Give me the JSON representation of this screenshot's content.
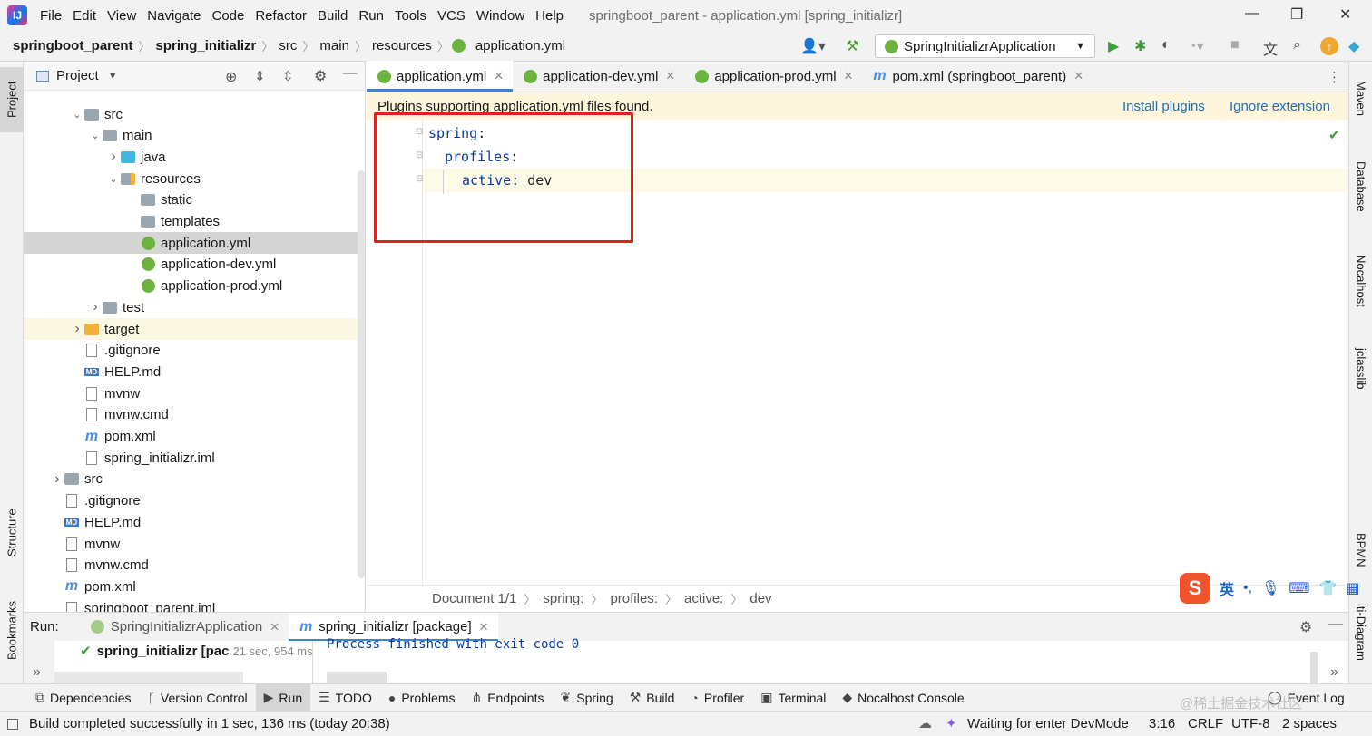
{
  "menubar": {
    "items": [
      "File",
      "Edit",
      "View",
      "Navigate",
      "Code",
      "Refactor",
      "Build",
      "Run",
      "Tools",
      "VCS",
      "Window",
      "Help"
    ],
    "window_title": "springboot_parent - application.yml [spring_initializr]"
  },
  "navbar": {
    "crumbs": [
      "springboot_parent",
      "spring_initializr",
      "src",
      "main",
      "resources",
      "application.yml"
    ],
    "run_config": "SpringInitializrApplication"
  },
  "left_strip": {
    "project": "Project",
    "structure": "Structure",
    "bookmarks": "Bookmarks"
  },
  "right_strip": {
    "maven": "Maven",
    "database": "Database",
    "nocalhost": "Nocalhost",
    "jclasslib": "jclasslib",
    "bpmn": "BPMN",
    "diagram": "iti-Diagram"
  },
  "project": {
    "title": "Project",
    "tree": [
      {
        "label": "src",
        "type": "folder",
        "arrow": "down"
      },
      {
        "label": "main",
        "type": "folder",
        "arrow": "down"
      },
      {
        "label": "java",
        "type": "folder-blue",
        "arrow": "right"
      },
      {
        "label": "resources",
        "type": "folder-res",
        "arrow": "down"
      },
      {
        "label": "static",
        "type": "folder",
        "arrow": ""
      },
      {
        "label": "templates",
        "type": "folder",
        "arrow": ""
      },
      {
        "label": "application.yml",
        "type": "spring",
        "arrow": ""
      },
      {
        "label": "application-dev.yml",
        "type": "spring",
        "arrow": ""
      },
      {
        "label": "application-prod.yml",
        "type": "spring",
        "arrow": ""
      },
      {
        "label": "test",
        "type": "folder",
        "arrow": "right"
      },
      {
        "label": "target",
        "type": "folder-orange",
        "arrow": "right"
      },
      {
        "label": ".gitignore",
        "type": "file",
        "arrow": ""
      },
      {
        "label": "HELP.md",
        "type": "md",
        "arrow": ""
      },
      {
        "label": "mvnw",
        "type": "file",
        "arrow": ""
      },
      {
        "label": "mvnw.cmd",
        "type": "file",
        "arrow": ""
      },
      {
        "label": "pom.xml",
        "type": "maven",
        "arrow": ""
      },
      {
        "label": "spring_initializr.iml",
        "type": "file",
        "arrow": ""
      },
      {
        "label": "src",
        "type": "folder",
        "arrow": "right"
      },
      {
        "label": ".gitignore",
        "type": "file",
        "arrow": ""
      },
      {
        "label": "HELP.md",
        "type": "md",
        "arrow": ""
      },
      {
        "label": "mvnw",
        "type": "file",
        "arrow": ""
      },
      {
        "label": "mvnw.cmd",
        "type": "file",
        "arrow": ""
      },
      {
        "label": "pom.xml",
        "type": "maven",
        "arrow": ""
      },
      {
        "label": "springboot_parent.iml",
        "type": "file",
        "arrow": ""
      }
    ]
  },
  "editor": {
    "tabs": [
      {
        "label": "application.yml",
        "icon": "spring"
      },
      {
        "label": "application-dev.yml",
        "icon": "spring"
      },
      {
        "label": "application-prod.yml",
        "icon": "spring"
      },
      {
        "label": "pom.xml (springboot_parent)",
        "icon": "maven"
      }
    ],
    "banner": {
      "text": "Plugins supporting application.yml files found.",
      "install": "Install plugins",
      "ignore": "Ignore extension"
    },
    "code": [
      {
        "key": "spring",
        "colon": ":",
        "value": ""
      },
      {
        "key": "profiles",
        "colon": ":",
        "value": ""
      },
      {
        "key": "active",
        "colon": ":",
        "value": " dev"
      }
    ],
    "breadcrumb": [
      "Document 1/1",
      "spring:",
      "profiles:",
      "active:",
      "dev"
    ]
  },
  "run": {
    "label": "Run:",
    "tabs": [
      "SpringInitializrApplication",
      "spring_initializr [package]"
    ],
    "tree_item": "spring_initializr [pac",
    "duration": "21 sec, 954 ms",
    "console": "Process finished with exit code 0"
  },
  "toolwindows": [
    "Dependencies",
    "Version Control",
    "Run",
    "TODO",
    "Problems",
    "Endpoints",
    "Spring",
    "Build",
    "Profiler",
    "Terminal",
    "Nocalhost Console",
    "Event Log"
  ],
  "statusbar": {
    "message": "Build completed successfully in 1 sec, 136 ms (today 20:38)",
    "devmode": "Waiting for enter DevMode",
    "position": "3:16",
    "line_sep": "CRLF",
    "encoding": "UTF-8",
    "indent": "2 spaces"
  },
  "ime": {
    "lang": "英"
  },
  "watermark": "@稀土掘金技术社区"
}
